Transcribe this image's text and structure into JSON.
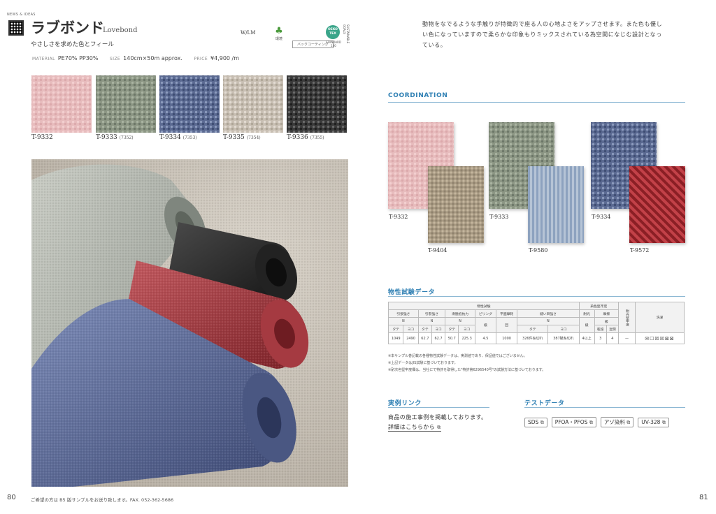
{
  "left_page": {
    "news_tag": "NEWS & IDEAS",
    "title_jp": "ラブボンド",
    "title_en": "Lovebond",
    "subtitle": "やさしさを求めた色とフィール",
    "spec": {
      "material_label": "MATERIAL",
      "material_value": "PE70% PP30%",
      "size_label": "SIZE",
      "size_value": "140cm×50m approx.",
      "price_label": "PRICE",
      "price_value": "¥4,900 /m"
    },
    "badges": {
      "wlm": "W/LM",
      "eco_caption": "環境",
      "backcoat": "バックコーティング",
      "oeko": "OEKO TEX",
      "oeko_std": "STANDARD 100",
      "sdgs": "SUSTAINABLE GOALS"
    },
    "swatches": [
      {
        "code": "T-9332",
        "sub": "",
        "color": "pink"
      },
      {
        "code": "T-9333",
        "sub": "(7352)",
        "color": "green"
      },
      {
        "code": "T-9334",
        "sub": "(7353)",
        "color": "blue"
      },
      {
        "code": "T-9335",
        "sub": "(7354)",
        "color": "beige"
      },
      {
        "code": "T-9336",
        "sub": "(7355)",
        "color": "black"
      }
    ],
    "page_number": "80",
    "footer_note": "ご希望の方は B5 版サンプルをお送り致します。FAX. 052-362-5686"
  },
  "right_page": {
    "description": "動物をなでるような手触りが特徴的で座る人の心地よさをアップさせます。また色も優しい色になっていますので柔らかな印象もりミックスされている為空間になじむ設計となっている。",
    "coordination": {
      "heading": "COORDINATION",
      "pairs": [
        {
          "main": "T-9332",
          "accent": "T-9404"
        },
        {
          "main": "T-9333",
          "accent": "T-9580"
        },
        {
          "main": "T-9334",
          "accent": "T-9572"
        }
      ]
    },
    "physical": {
      "heading": "物性試験データ",
      "group_top": "物性試験",
      "group_color": "染色堅牢度",
      "wash_col": "洗濯",
      "wash_vertical": "耐光堅牢度",
      "cols": {
        "tensile": "引張強さ",
        "tensile2": "引裂強さ",
        "seam": "滑脱抵抗力",
        "pilling": "ピリング",
        "abrasion": "平面摩耗",
        "slip": "縫い目強さ",
        "light": "耐光",
        "rub": "摩擦",
        "rub_dry": "乾燥",
        "rub_wet": "湿潤"
      },
      "units": {
        "n": "N",
        "grade": "級",
        "times": "回"
      },
      "dirs": {
        "warp": "タテ",
        "weft": "ヨコ"
      },
      "values": [
        "1049",
        "2490",
        "62.7",
        "62.7",
        "50.7",
        "225.3",
        "4.5",
        "1000",
        "326件糸切れ",
        "387破糸切れ",
        "4以上",
        "3",
        "4",
        "—"
      ],
      "wash_icons": "✉☐☒☒⊠⊠",
      "notes": [
        "※本サンプル巻記載の各種物性試験データは、実測値であり、保証値ではございません。",
        "※上記データはJIS試験に基づいております。",
        "※耐次色堅牢度欄は、当社にて特許を取得した\"特許第6296540号\"の試験方法に基づいております。"
      ]
    },
    "case_link": {
      "heading": "実例リンク",
      "line1": "商品の施工事例を掲載しております。",
      "line2": "詳細はこちらから"
    },
    "test_data": {
      "heading": "テストデータ",
      "tags": [
        "SDS",
        "PFOA・PFOS",
        "アゾ染料",
        "UV-328"
      ]
    },
    "page_number": "81"
  }
}
